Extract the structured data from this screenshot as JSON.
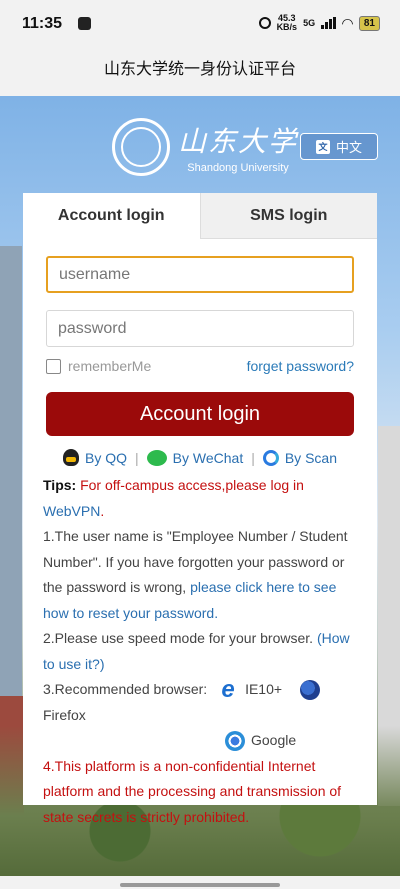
{
  "status_bar": {
    "time": "11:35",
    "speed_value": "45.3",
    "speed_unit": "KB/s",
    "network": "5G",
    "battery": "81"
  },
  "app_bar": {
    "title": "山东大学统一身份认证平台"
  },
  "header": {
    "logo_cn": "山东大学",
    "logo_en": "Shandong University",
    "language_button": "中文"
  },
  "tabs": [
    {
      "label": "Account login",
      "active": true
    },
    {
      "label": "SMS login",
      "active": false
    }
  ],
  "form": {
    "username_placeholder": "username",
    "password_placeholder": "password",
    "remember_label": "rememberMe",
    "forget_label": "forget password?",
    "submit_label": "Account login"
  },
  "social": {
    "qq": "By QQ",
    "wechat": "By WeChat",
    "scan": "By Scan",
    "separator": "|"
  },
  "tips": {
    "label": "Tips:",
    "text_before": " For off-campus access,please log in ",
    "webvpn": "WebVPN",
    "text_after": "."
  },
  "notes": {
    "n1_text": "1.The user name is \"Employee Number / Student Number\". If you have forgotten your password or the password is wrong, ",
    "n1_link": "please click here to see how to reset your password.",
    "n2_text": "2.Please use speed mode for your browser. ",
    "n2_link": "(How to use it?)",
    "n3_text": "3.Recommended browser:",
    "browsers": {
      "ie": "IE10+",
      "firefox": "Firefox",
      "chrome": "Google"
    },
    "n4_text": "4.This platform is a non-confidential Internet platform and the processing and transmission of state secrets is strictly prohibited."
  },
  "colors": {
    "primary_button": "#9b0a0a",
    "link": "#2a6fb0",
    "warning": "#c41010",
    "focus_border": "#e6a020"
  }
}
